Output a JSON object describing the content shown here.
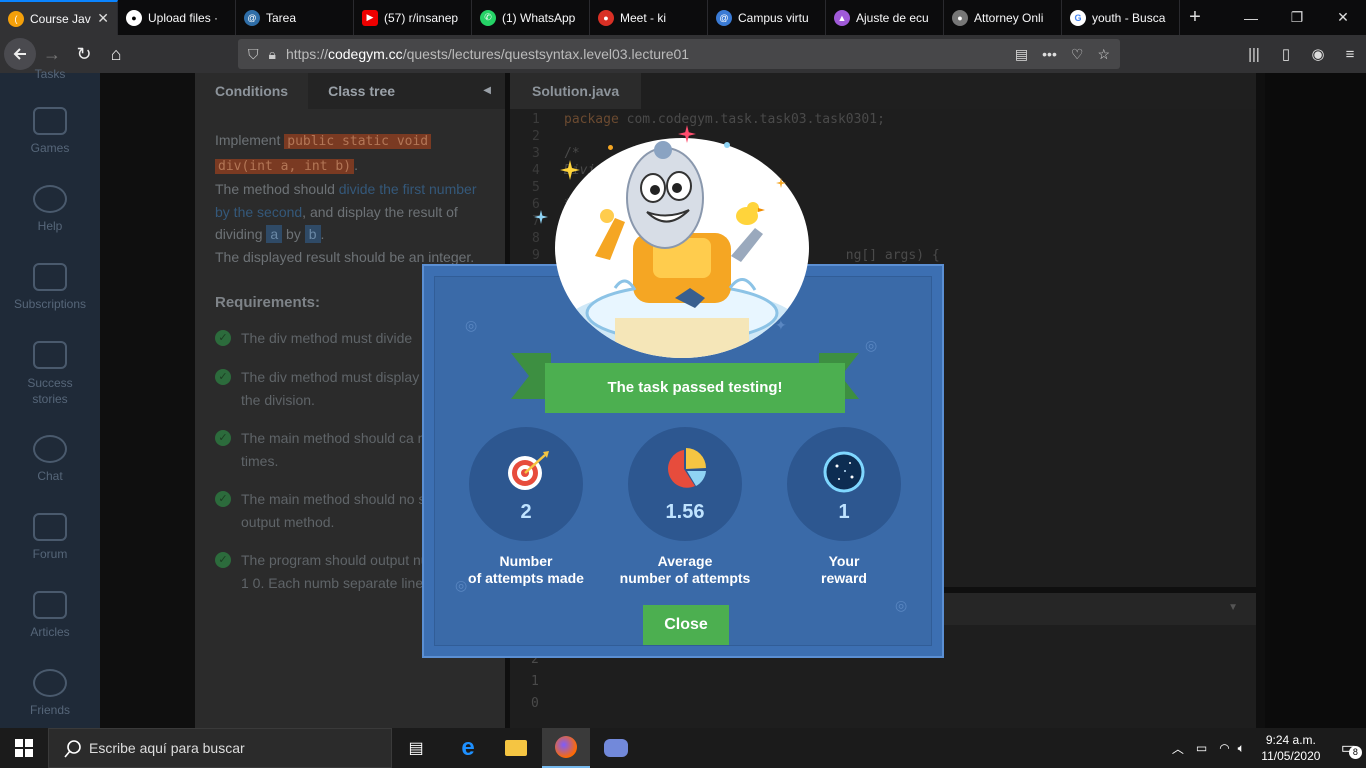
{
  "browser": {
    "tabs": [
      {
        "label": "Course Jav",
        "color": "#f4a00a",
        "glyph": "(",
        "active": true
      },
      {
        "label": "Upload files ·",
        "color": "#333",
        "glyph": "●"
      },
      {
        "label": "Tarea",
        "color": "#2f6ea8",
        "glyph": "@"
      },
      {
        "label": "(57) r/insanep",
        "color": "#e00",
        "glyph": "▶"
      },
      {
        "label": "(1) WhatsApp",
        "color": "#25d366",
        "glyph": "✆"
      },
      {
        "label": "Meet - ki",
        "color": "#d93025",
        "glyph": "●"
      },
      {
        "label": "Campus virtu",
        "color": "#3a7bd5",
        "glyph": "@"
      },
      {
        "label": "Ajuste de ecu",
        "color": "#a05ad8",
        "glyph": "▲"
      },
      {
        "label": "Attorney Onli",
        "color": "#777",
        "glyph": "●"
      },
      {
        "label": "youth - Busca",
        "color": "#4285f4",
        "glyph": "G"
      }
    ],
    "url_prefix": "https://",
    "url_host": "codegym.cc",
    "url_path": "/quests/lectures/questsyntax.level03.lecture01"
  },
  "sidebar": {
    "items": [
      {
        "label": "Tasks"
      },
      {
        "label": "Games"
      },
      {
        "label": "Help"
      },
      {
        "label": "Subscriptions"
      },
      {
        "label": "Success stories"
      },
      {
        "label": "Chat"
      },
      {
        "label": "Forum"
      },
      {
        "label": "Articles"
      },
      {
        "label": "Friends"
      }
    ]
  },
  "conditions": {
    "tab_conditions": "Conditions",
    "tab_class_tree": "Class tree",
    "implement": "Implement ",
    "code_signature_1": "public static void",
    "code_signature_2": "div(int a, int b)",
    "period": ".",
    "method_should": "The method should ",
    "divide_link": "divide the first number by the second",
    "and_display": ", and display the result of dividing ",
    "var_a": "a",
    "by": " by ",
    "var_b": "b",
    "period2": ".",
    "integer_note": "The displayed result should be an integer.",
    "requirements_title": "Requirements:",
    "requirements": [
      "The div method must divide",
      "The div method must display result of the division.",
      "The main method should ca method 3 times.",
      "The main method should no screen output method.",
      "The program should output numbers: 2 1 0. Each numb separate line."
    ]
  },
  "editor": {
    "file_tab": "Solution.java",
    "lines": [
      {
        "n": "1",
        "text": "package com.codegym.task.task03.task0301;"
      },
      {
        "n": "2",
        "text": ""
      },
      {
        "n": "3",
        "text": "/*"
      },
      {
        "n": "4",
        "text": "Dividing"
      },
      {
        "n": "5",
        "text": ""
      },
      {
        "n": "6",
        "text": "*/"
      },
      {
        "n": "7",
        "text": ""
      },
      {
        "n": "8",
        "text": "p"
      },
      {
        "n": "9",
        "text": "                                    ng[] args) {"
      }
    ],
    "console_output": [
      "2",
      "1",
      "0"
    ]
  },
  "modal": {
    "banner": "The task passed testing!",
    "stats": [
      {
        "value": "2",
        "label_line1": "Number",
        "label_line2": "of attempts made",
        "icon": "target-icon"
      },
      {
        "value": "1.56",
        "label_line1": "Average",
        "label_line2": "number of attempts",
        "icon": "pie-chart-icon"
      },
      {
        "value": "1",
        "label_line1": "Your",
        "label_line2": "reward",
        "icon": "starry-orb-icon"
      }
    ],
    "close_label": "Close"
  },
  "taskbar": {
    "search_placeholder": "Escribe aquí para buscar",
    "time": "9:24 a.m.",
    "date": "11/05/2020",
    "notification_count": "8"
  },
  "colors": {
    "accent_green": "#4caf50",
    "modal_blue": "#3a6aa8",
    "firefox_blue": "#0a84ff"
  }
}
